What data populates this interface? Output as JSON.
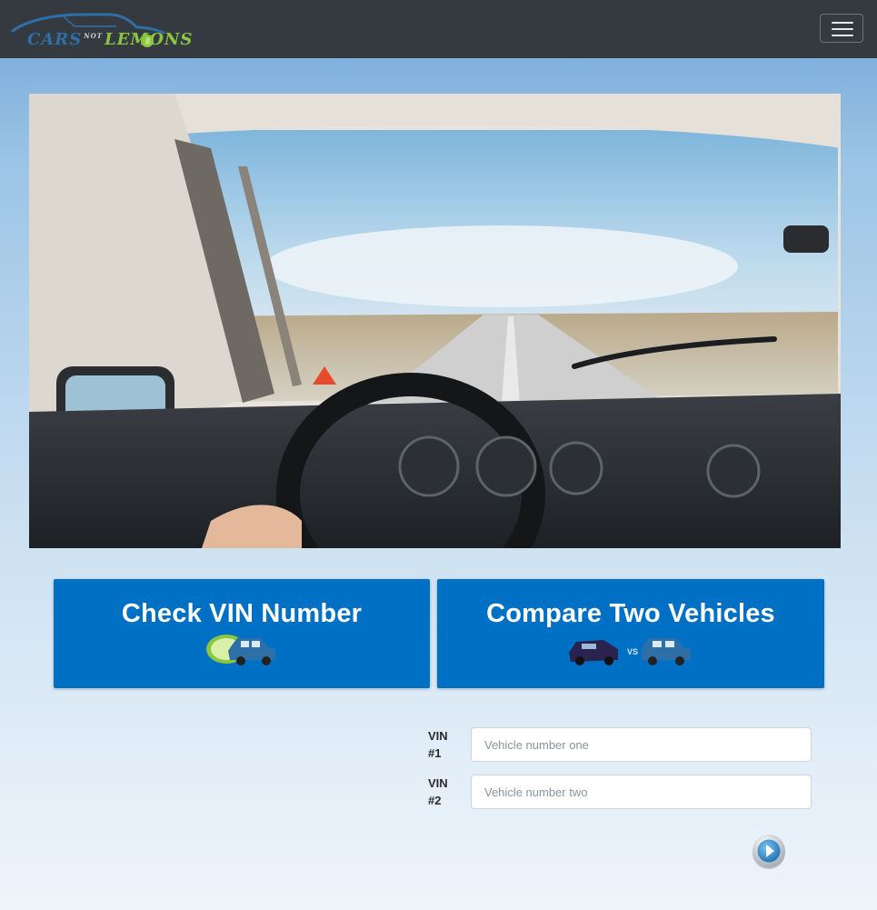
{
  "navbar": {
    "brand": {
      "word1": "CARS",
      "word2": "NOT",
      "word3": "LEMONS"
    }
  },
  "actions": {
    "check_vin": {
      "label": "Check VIN Number"
    },
    "compare": {
      "label": "Compare Two Vehicles",
      "vs": "VS"
    }
  },
  "form": {
    "vin1": {
      "label_line1": "VIN",
      "label_line2": "#1",
      "placeholder": "Vehicle number one",
      "value": ""
    },
    "vin2": {
      "label_line1": "VIN",
      "label_line2": "#2",
      "placeholder": "Vehicle number two",
      "value": ""
    }
  },
  "colors": {
    "navbar_bg": "#343a40",
    "action_blue": "#0070c4",
    "logo_blue": "#2e6fa8",
    "logo_green": "#8cc63f"
  }
}
